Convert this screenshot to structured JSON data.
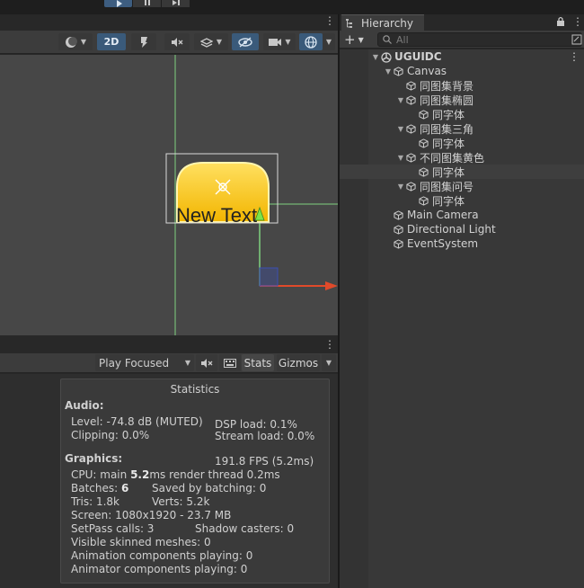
{
  "scene_toolbar": {
    "mode_2d": "2D"
  },
  "scene": {
    "button_text": "New Text"
  },
  "game_toolbar": {
    "play_mode": "Play Focused",
    "stats_label": "Stats",
    "gizmos_label": "Gizmos"
  },
  "hierarchy": {
    "tab_label": "Hierarchy",
    "search_placeholder": "All",
    "items": [
      {
        "label": "UGUIDC",
        "depth": 0,
        "caret": "down",
        "icon": "unity-scene-icon",
        "bold": true
      },
      {
        "label": "Canvas",
        "depth": 1,
        "caret": "down",
        "icon": "gameobject-icon"
      },
      {
        "label": "同图集背景",
        "depth": 2,
        "caret": "",
        "icon": "gameobject-icon"
      },
      {
        "label": "同图集椭圆",
        "depth": 2,
        "caret": "down",
        "icon": "gameobject-icon"
      },
      {
        "label": "同字体",
        "depth": 3,
        "caret": "",
        "icon": "gameobject-icon"
      },
      {
        "label": "同图集三角",
        "depth": 2,
        "caret": "down",
        "icon": "gameobject-icon"
      },
      {
        "label": "同字体",
        "depth": 3,
        "caret": "",
        "icon": "gameobject-icon"
      },
      {
        "label": "不同图集黄色",
        "depth": 2,
        "caret": "down",
        "icon": "gameobject-icon"
      },
      {
        "label": "同字体",
        "depth": 3,
        "caret": "",
        "icon": "gameobject-icon",
        "selected": true
      },
      {
        "label": "同图集问号",
        "depth": 2,
        "caret": "down",
        "icon": "gameobject-icon"
      },
      {
        "label": "同字体",
        "depth": 3,
        "caret": "",
        "icon": "gameobject-icon"
      },
      {
        "label": "Main Camera",
        "depth": 1,
        "caret": "",
        "icon": "gameobject-icon"
      },
      {
        "label": "Directional Light",
        "depth": 1,
        "caret": "",
        "icon": "gameobject-icon"
      },
      {
        "label": "EventSystem",
        "depth": 1,
        "caret": "",
        "icon": "gameobject-icon"
      }
    ]
  },
  "statistics": {
    "title": "Statistics",
    "audio_heading": "Audio:",
    "level": "Level: -74.8 dB (MUTED)",
    "clipping": "Clipping: 0.0%",
    "dsp_load": "DSP load: 0.1%",
    "stream_load": "Stream load: 0.0%",
    "graphics_heading": "Graphics:",
    "fps": "191.8 FPS (5.2ms)",
    "cpu_prefix": "CPU: main ",
    "cpu_main": "5.2",
    "cpu_suffix": "ms  render thread 0.2ms",
    "batches_prefix": "Batches: ",
    "batches": "6",
    "saved_by_batching": "Saved by batching: 0",
    "tris": "Tris: 1.8k",
    "verts": "Verts: 5.2k",
    "screen": "Screen: 1080x1920 - 23.7 MB",
    "setpass": "SetPass calls: 3",
    "shadow_casters": "Shadow casters: 0",
    "skinned": "Visible skinned meshes: 0",
    "animation": "Animation components playing: 0",
    "animator": "Animator components playing: 0"
  }
}
